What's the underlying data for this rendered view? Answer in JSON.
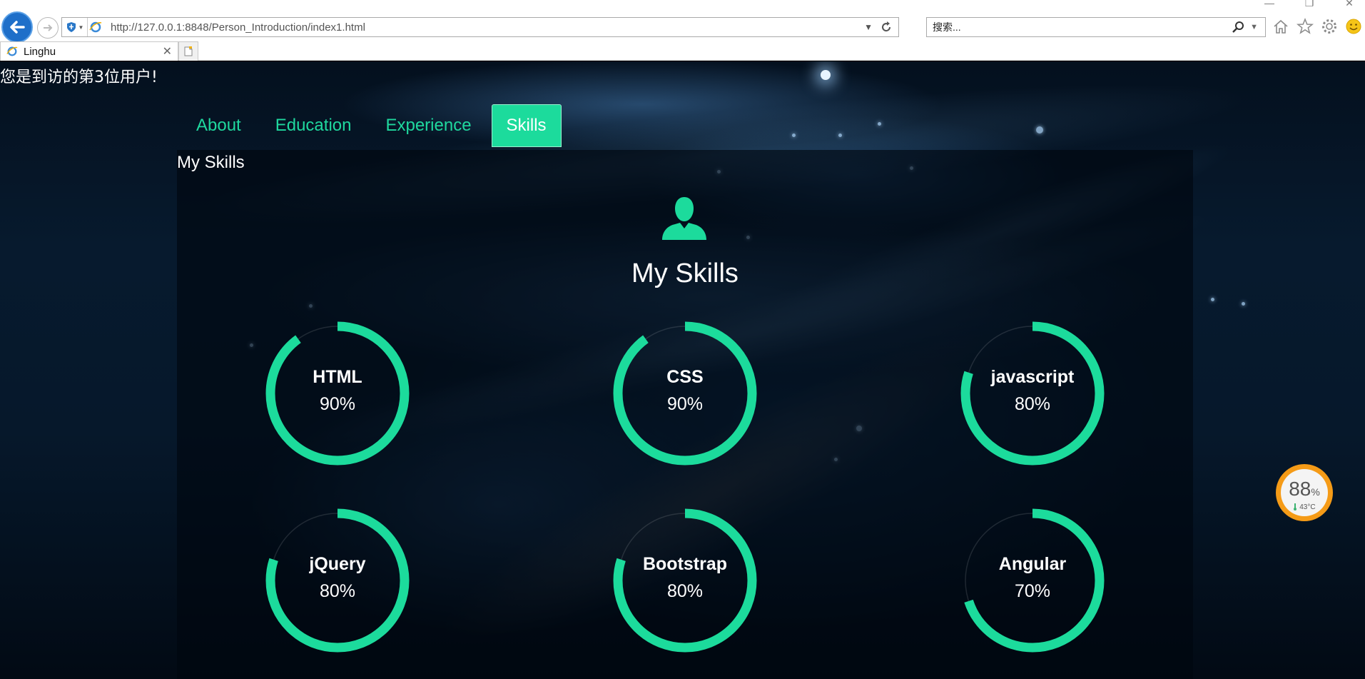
{
  "browser": {
    "url": "http://127.0.0.1:8848/Person_Introduction/index1.html",
    "search_placeholder": "搜索...",
    "tab_title": "Linghu"
  },
  "page": {
    "visitor_text": "您是到访的第3位用户!",
    "nav": [
      {
        "label": "About",
        "active": false
      },
      {
        "label": "Education",
        "active": false
      },
      {
        "label": "Experience",
        "active": false
      },
      {
        "label": "Skills",
        "active": true
      }
    ],
    "panel_label": "My Skills",
    "heading": "My Skills",
    "accent_color": "#1cdb9c",
    "skills": [
      {
        "name": "HTML",
        "value_text": "90%",
        "percent": 90
      },
      {
        "name": "CSS",
        "value_text": "90%",
        "percent": 90
      },
      {
        "name": "javascript",
        "value_text": "80%",
        "percent": 80
      },
      {
        "name": "jQuery",
        "value_text": "80%",
        "percent": 80
      },
      {
        "name": "Bootstrap",
        "value_text": "80%",
        "percent": 80
      },
      {
        "name": "Angular",
        "value_text": "70%",
        "percent": 70
      }
    ]
  },
  "widget": {
    "percent": "88",
    "percent_sign": "%",
    "temperature": "43°C"
  }
}
